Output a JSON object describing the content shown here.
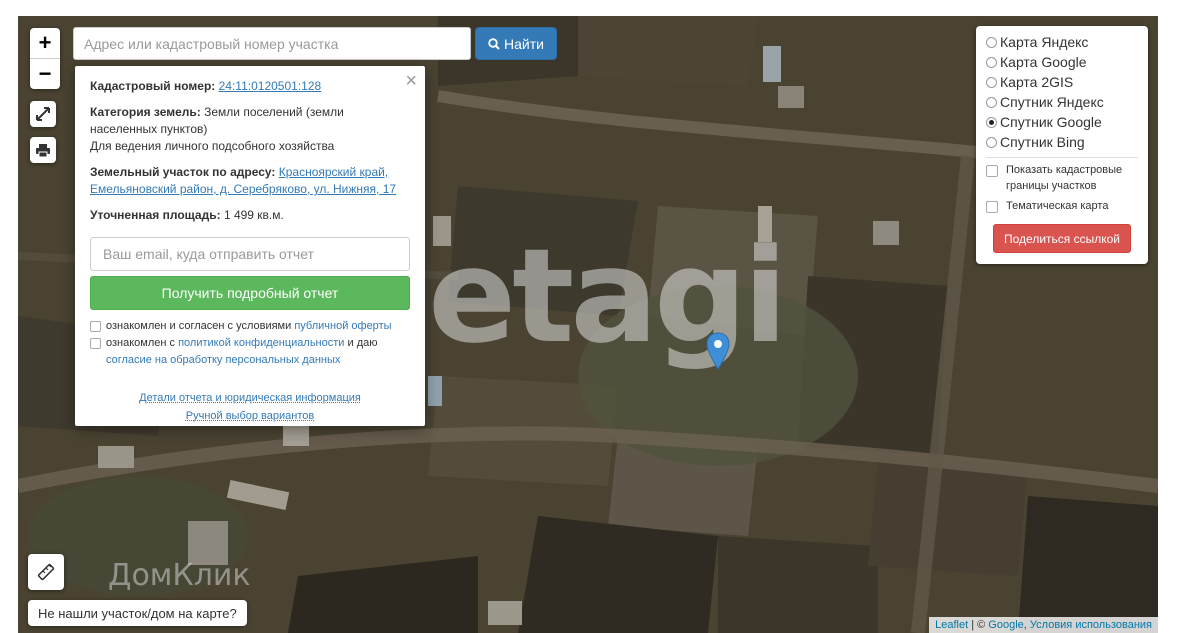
{
  "map": {
    "zoom_in": "+",
    "zoom_out": "−",
    "watermark": "etagi",
    "watermark_bottom": "ДомКлик",
    "icons": [
      "fullscreen-icon",
      "print-icon",
      "ruler-icon",
      "map-marker-icon",
      "search-icon"
    ],
    "marker_color": "#3f8fd8"
  },
  "search": {
    "placeholder": "Адрес или кадастровый номер участка",
    "button_label": "Найти"
  },
  "popup": {
    "close": "×",
    "cadastral_label": "Кадастровый номер:",
    "cadastral_value": "24:11:0120501:128",
    "category_label": "Категория земель:",
    "category_value": "Земли поселений (земли населенных пунктов)",
    "purpose": "Для ведения личного подсобного хозяйства",
    "address_label": "Земельный участок по адресу:",
    "address_value": "Красноярский край, Емельяновский район, д. Серебряково, ул. Нижняя, 17",
    "area_label": "Уточненная площадь:",
    "area_value": "1 499 кв.м.",
    "email_placeholder": "Ваш email, куда отправить отчет",
    "report_button": "Получить подробный отчет",
    "agree1_text": "ознакомлен и согласен с условиями",
    "agree1_link": "публичной оферты",
    "agree2_text": "ознакомлен с",
    "agree2_link": "политикой конфиденциальности",
    "agree2_mid": "и даю",
    "agree2_link2": "согласие на обработку персональных данных",
    "details_link": "Детали отчета и юридическая информация",
    "manual_link": "Ручной выбор вариантов"
  },
  "layers": {
    "options": [
      {
        "label": "Карта Яндекс",
        "selected": false
      },
      {
        "label": "Карта Google",
        "selected": false
      },
      {
        "label": "Карта 2GIS",
        "selected": false
      },
      {
        "label": "Спутник Яндекс",
        "selected": false
      },
      {
        "label": "Спутник Google",
        "selected": true
      },
      {
        "label": "Спутник Bing",
        "selected": false
      }
    ],
    "show_cadastral": "Показать кадастровые границы участков",
    "thematic_map": "Тематическая карта",
    "share_button": "Поделиться ссылкой"
  },
  "not_found_button": "Не нашли участок/дом на карте?",
  "attribution": {
    "leaflet": "Leaflet",
    "sep": " | © ",
    "google": "Google",
    "terms": "Условия использования"
  },
  "colors": {
    "search_button": "#337ab7",
    "report_button": "#5cb85c",
    "share_button": "#d9534f",
    "link": "#337ab7"
  }
}
